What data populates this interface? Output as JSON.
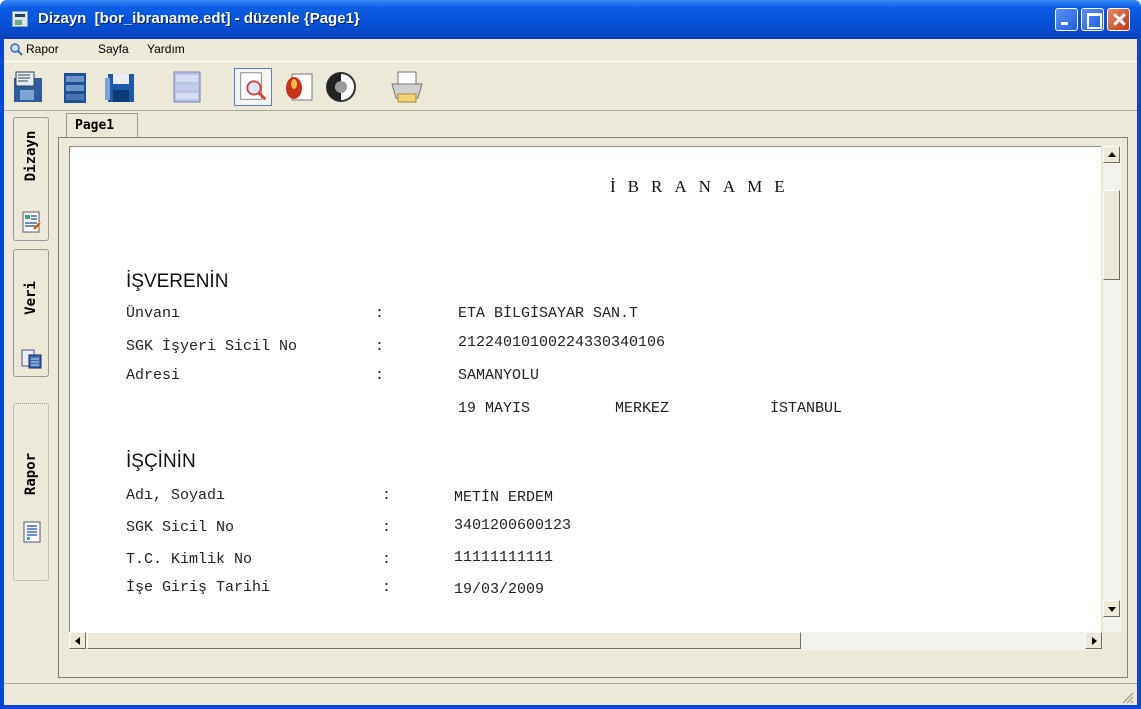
{
  "window": {
    "title": "Dizayn  [bor_ibraname.edt] - düzenle {Page1}"
  },
  "menu": {
    "items": [
      "Rapor",
      "Sayfa",
      "Yardım"
    ]
  },
  "toolbar": {
    "icons": [
      "data-icon",
      "database-icon",
      "save-icon",
      "panel-icon",
      "preview-icon",
      "edit-icon",
      "theme-icon",
      "print-icon"
    ],
    "pressed": "preview-icon"
  },
  "left_tabs": {
    "dizayn": "Dizayn",
    "veri": "Veri",
    "rapor": "Rapor"
  },
  "page_tab": "Page1",
  "document": {
    "title": "İBRANAME",
    "employer_heading": "İŞVERENİN",
    "employer_fields": [
      {
        "label": "Ünvanı",
        "colon": ":",
        "value": "ETA BİLGİSAYAR SAN.T"
      },
      {
        "label": "SGK İşyeri Sicil No",
        "colon": ":",
        "value": "21224010100224330340106"
      },
      {
        "label": "Adresi",
        "colon": ":",
        "value": "SAMANYOLU"
      }
    ],
    "address_line2": {
      "district": "19 MAYIS",
      "area": "MERKEZ",
      "city": "İSTANBUL"
    },
    "employee_heading": "İŞÇİNİN",
    "employee_fields": [
      {
        "label": "Adı, Soyadı",
        "colon": ":",
        "value": "METİN ERDEM"
      },
      {
        "label": "SGK Sicil No",
        "colon": ":",
        "value": "3401200600123"
      },
      {
        "label": "T.C. Kimlik No",
        "colon": ":",
        "value": "11111111111"
      },
      {
        "label": "İşe Giriş Tarihi",
        "colon": ":",
        "value": "19/03/2009"
      }
    ]
  },
  "colors": {
    "titlebar": "#0752d8",
    "chrome": "#ece9d8",
    "close": "#c2351a"
  }
}
